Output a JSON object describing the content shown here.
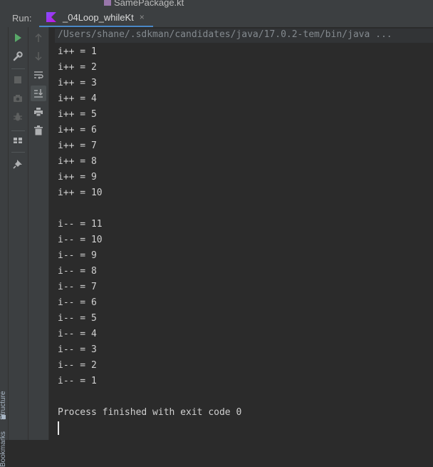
{
  "editor_tab": {
    "filename": "SamePackage.kt"
  },
  "run_panel": {
    "label": "Run:",
    "tab_title": "_04Loop_whileKt",
    "close_glyph": "×"
  },
  "side_labels": {
    "structure": "Structure",
    "bookmarks": "Bookmarks"
  },
  "toolbar_icons": {
    "left": [
      "play-icon",
      "wrench-icon",
      "stop-icon",
      "camera-icon",
      "debug-bug-icon",
      "layout-icon",
      "pin-icon"
    ],
    "right": [
      "arrow-up-icon",
      "arrow-down-icon",
      "soft-wrap-icon",
      "scroll-to-end-icon",
      "print-icon",
      "trash-icon"
    ]
  },
  "console": {
    "command": "/Users/shane/.sdkman/candidates/java/17.0.2-tem/bin/java ...",
    "lines": [
      "i++ = 1",
      "i++ = 2",
      "i++ = 3",
      "i++ = 4",
      "i++ = 5",
      "i++ = 6",
      "i++ = 7",
      "i++ = 8",
      "i++ = 9",
      "i++ = 10",
      "",
      "i-- = 11",
      "i-- = 10",
      "i-- = 9",
      "i-- = 8",
      "i-- = 7",
      "i-- = 6",
      "i-- = 5",
      "i-- = 4",
      "i-- = 3",
      "i-- = 2",
      "i-- = 1",
      "",
      "Process finished with exit code 0"
    ]
  },
  "colors": {
    "panel_bg": "#3c3f41",
    "console_bg": "#2b2b2b",
    "accent": "#4a88c7",
    "run_green": "#59a869",
    "text": "#d0d0d0"
  }
}
